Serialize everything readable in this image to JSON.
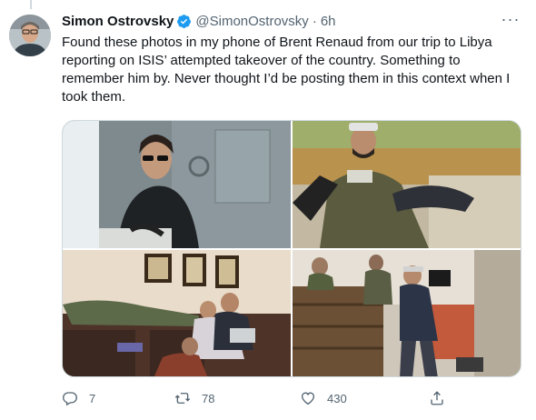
{
  "tweet": {
    "author_name": "Simon Ostrovsky",
    "handle": "@SimonOstrovsky",
    "separator": "·",
    "time": "6h",
    "verified_badge": "verified-badge-icon",
    "text": "Found these photos in my phone of Brent Renaud from our trip to Libya reporting on ISIS’ attempted takeover of the country. Something to remember him by. Never thought I’d be posting them in this context when I took them.",
    "more_label": "···"
  },
  "actions": {
    "reply_icon": "reply-icon",
    "reply_count": "7",
    "retweet_icon": "retweet-icon",
    "retweet_count": "78",
    "like_icon": "heart-icon",
    "like_count": "430",
    "share_icon": "share-icon"
  },
  "colors": {
    "text": "#0f1419",
    "secondary": "#536471",
    "verified": "#1d9bf0",
    "border": "#cfd9de"
  }
}
